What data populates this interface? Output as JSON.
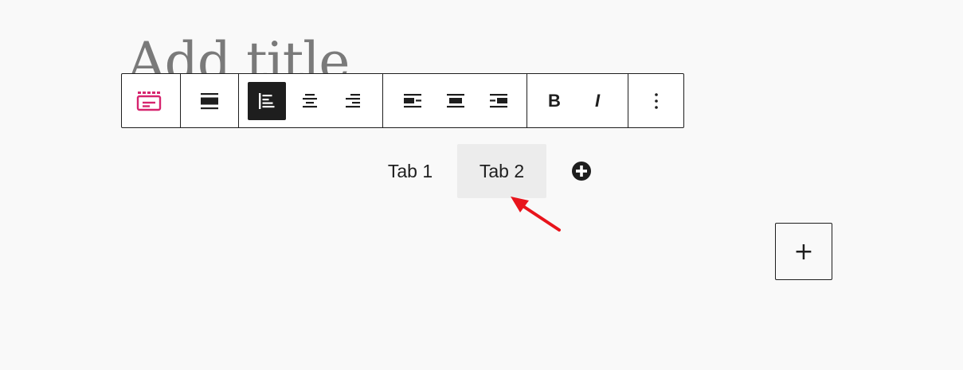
{
  "editor": {
    "title_placeholder": "Add title"
  },
  "toolbar": {
    "block_icon": "tabs-block-icon",
    "block_color": "#d6246e",
    "buttons": [
      {
        "name": "change-alignment-button",
        "icon": "align-wide-icon"
      },
      {
        "name": "tabs-align-left-button",
        "icon": "align-left-icon",
        "active": true
      },
      {
        "name": "tabs-align-center-button",
        "icon": "align-center-icon"
      },
      {
        "name": "tabs-align-right-button",
        "icon": "align-right-icon"
      },
      {
        "name": "content-align-left-button",
        "icon": "media-left-icon"
      },
      {
        "name": "content-align-center-button",
        "icon": "media-center-icon"
      },
      {
        "name": "content-align-right-button",
        "icon": "media-right-icon"
      },
      {
        "name": "options-button",
        "icon": "more-vertical-icon"
      }
    ],
    "bold_label": "B",
    "italic_label": "I"
  },
  "tabs": {
    "items": [
      {
        "label": "Tab 1",
        "selected": false
      },
      {
        "label": "Tab 2",
        "selected": true
      }
    ],
    "add_icon": "plus-circle-icon"
  },
  "block_adder": {
    "label": "+"
  },
  "annotation": {
    "arrow_color": "#e8141c"
  }
}
